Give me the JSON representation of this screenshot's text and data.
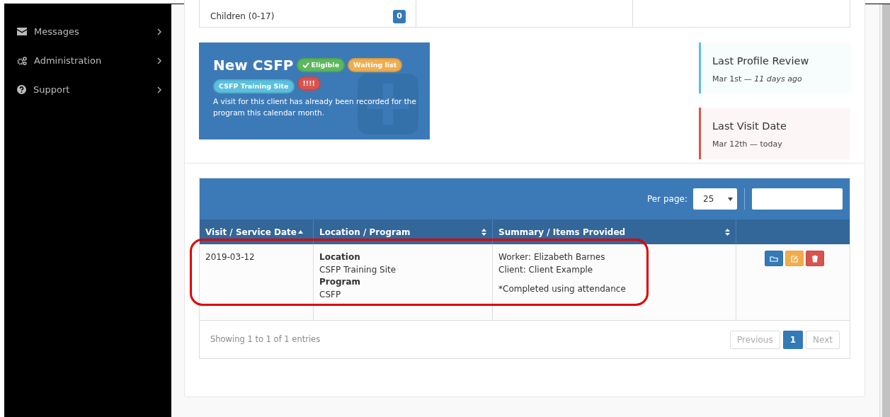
{
  "sidebar": {
    "items": [
      {
        "kind": "envelope",
        "label": "Messages"
      },
      {
        "kind": "gears",
        "label": "Administration"
      },
      {
        "kind": "question",
        "label": "Support"
      }
    ]
  },
  "household_table": {
    "cells": [
      {
        "label": "Children (0-17)",
        "count": "0"
      },
      {},
      {}
    ]
  },
  "program_card": {
    "title": "New CSFP",
    "badges": [
      {
        "kind": "check",
        "label": "Eligible",
        "color": "#5cb85c"
      },
      {
        "kind": "plain",
        "label": "Waiting list",
        "color": "#f0ad4e"
      },
      {
        "kind": "plain",
        "label": "CSFP Training Site",
        "color": "#5bc0de"
      },
      {
        "kind": "plain",
        "label": "!!!!",
        "color": "#d9534f"
      }
    ],
    "message": "A visit for this client has already been recorded for the program this calendar month."
  },
  "callouts": [
    {
      "title": "Last Profile Review",
      "detail": "Mar 1st — *11 days ago*",
      "color": "#5bc0de"
    },
    {
      "title": "Last Visit Date",
      "detail": "Mar 12th — today",
      "color": "#d9534f"
    }
  ],
  "visits_table": {
    "per_page_label": "Per page:",
    "per_page": "25",
    "columns": [
      {
        "label": "Visit / Service Date",
        "sorted": true
      },
      {
        "label": "Location / Program",
        "sorted": false
      },
      {
        "label": "Summary / Items Provided",
        "sorted": false
      }
    ],
    "rows": [
      {
        "date": "2019-03-12",
        "location_program": "**Location**\nCSFP Training Site\n**Program**\nCSFP",
        "summary": [
          "Worker: Elizabeth Barnes",
          "Client: Client Example"
        ],
        "note": "*Completed using attendance",
        "highlighted": true,
        "actions": [
          {
            "kind": "open"
          },
          {
            "kind": "edit"
          },
          {
            "kind": "delete"
          }
        ]
      }
    ],
    "info": "Showing 1 to 1 of 1 entries",
    "pagination": [
      {
        "label": "Previous",
        "selected": false,
        "disabled": true
      },
      {
        "label": "1",
        "selected": true,
        "disabled": false
      },
      {
        "label": "Next",
        "selected": false,
        "disabled": true
      }
    ]
  }
}
